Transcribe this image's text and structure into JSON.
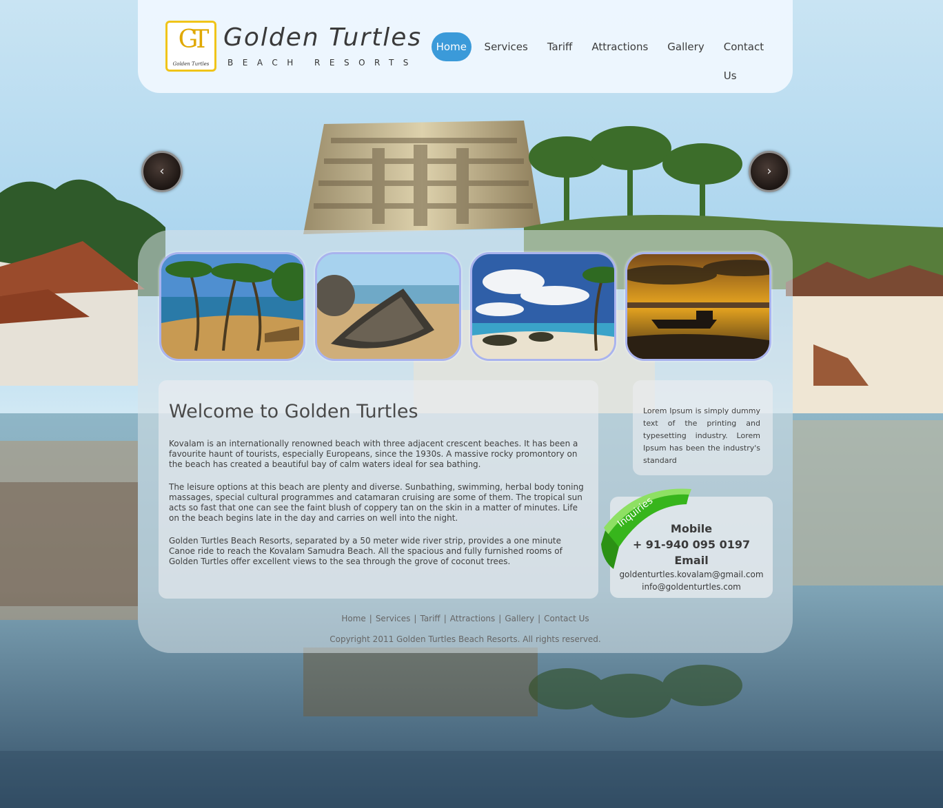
{
  "brand": {
    "monogram": "GT",
    "badge_text": "Golden Turtles",
    "name": "Golden Turtles",
    "tagline": "BEACH RESORTS"
  },
  "nav": {
    "items": [
      "Home",
      "Services",
      "Tariff",
      "Attractions",
      "Gallery",
      "Contact Us"
    ],
    "active": "Home"
  },
  "slider": {
    "prev_icon": "chevron-left-icon",
    "next_icon": "chevron-right-icon"
  },
  "thumbnails": [
    "palm-beach-photo",
    "wooden-boat-photo",
    "tropical-island-photo",
    "sunset-boat-photo"
  ],
  "welcome": {
    "title": "Welcome to Golden Turtles",
    "paragraphs": [
      "Kovalam is an internationally renowned beach with three adjacent crescent beaches. It has been a favourite haunt of tourists, especially Europeans, since the 1930s. A massive rocky promontory on the beach has created a beautiful bay of calm waters ideal for sea bathing.",
      "The leisure options at this beach are plenty and diverse. Sunbathing, swimming, herbal body toning massages, special cultural programmes and catamaran cruising are some of them. The tropical sun acts so fast that one can see the faint blush of coppery tan on the skin in a matter of minutes. Life on the beach begins late in the day and carries on well into the night.",
      "Golden Turtles Beach Resorts, separated by a 50 meter wide river strip, provides a one minute Canoe ride to reach the Kovalam Samudra Beach. All the spacious and fully furnished rooms of Golden Turtles offer excellent views to the sea through the grove of coconut trees."
    ]
  },
  "sidebar": {
    "text": "Lorem Ipsum is simply dummy text of the printing and typesetting industry. Lorem Ipsum has been the industry's standard"
  },
  "inquiries": {
    "ribbon": "Inquiries",
    "mobile_label": "Mobile",
    "mobile": "+ 91-940 095 0197",
    "email_label": "Email",
    "emails": [
      "goldenturtles.kovalam@gmail.com",
      "info@goldenturtles.com"
    ]
  },
  "footer": {
    "links": [
      "Home",
      "Services",
      "Tariff",
      "Attractions",
      "Gallery",
      "Contact Us"
    ],
    "copyright": "Copyright 2011 Golden Turtles Beach Resorts. All rights reserved."
  },
  "colors": {
    "nav_active": "#3b9ad9",
    "logo_gold": "#f0c419",
    "ribbon_green": "#3fbf1f",
    "thumb_border": "#a9b3ee"
  }
}
